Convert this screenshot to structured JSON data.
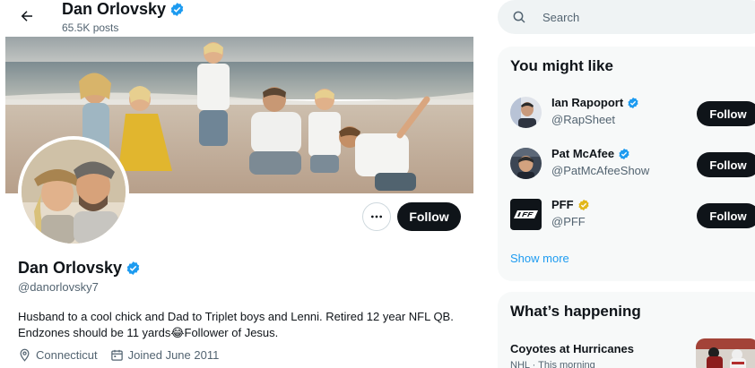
{
  "header": {
    "name": "Dan Orlovsky",
    "post_count": "65.5K posts"
  },
  "profile": {
    "name": "Dan Orlovsky",
    "handle": "@danorlovsky7",
    "bio_line1": "Husband to a cool chick and Dad to Triplet boys and Lenni. Retired 12 year NFL QB.",
    "bio_line2": "Endzones should be 11 yards😂Follower of Jesus.",
    "location": "Connecticut",
    "joined": "Joined June 2011",
    "follow_label": "Follow"
  },
  "search": {
    "placeholder": "Search"
  },
  "you_might_like": {
    "title": "You might like",
    "accounts": [
      {
        "name": "Ian Rapoport",
        "handle": "@RapSheet",
        "follow_label": "Follow",
        "badge_color": "#1d9bf0"
      },
      {
        "name": "Pat McAfee",
        "handle": "@PatMcAfeeShow",
        "follow_label": "Follow",
        "badge_color": "#1d9bf0"
      },
      {
        "name": "PFF",
        "handle": "@PFF",
        "follow_label": "Follow",
        "badge_color": "#e2b719"
      }
    ],
    "show_more": "Show more"
  },
  "whats_happening": {
    "title": "What’s happening",
    "trends": [
      {
        "title": "Coyotes at Hurricanes",
        "meta": "NHL · This morning"
      }
    ]
  },
  "colors": {
    "accent": "#1d9bf0",
    "verified": "#1d9bf0",
    "gold_verified": "#e2b719",
    "button_dark": "#0f1419"
  },
  "icons": {
    "back": "arrow-left-icon",
    "verified": "verified-badge-icon",
    "more": "more-dots-icon",
    "location": "location-pin-icon",
    "calendar": "calendar-icon",
    "search": "search-icon"
  }
}
